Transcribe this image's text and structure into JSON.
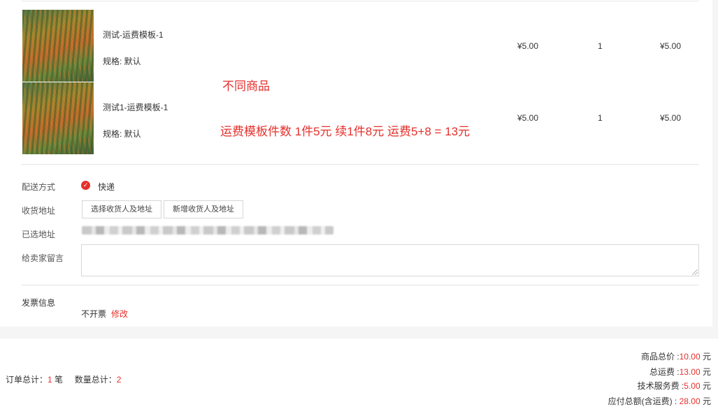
{
  "products": [
    {
      "name": "测试-运费模板-1",
      "spec": "规格: 默认",
      "price": "¥5.00",
      "qty": "1",
      "subtotal": "¥5.00"
    },
    {
      "name": "测试1-运费模板-1",
      "spec": "规格: 默认",
      "price": "¥5.00",
      "qty": "1",
      "subtotal": "¥5.00"
    }
  ],
  "annotations": {
    "different_products": "不同商品",
    "shipping_calc": "运费模板件数  1件5元 续1件8元 运费5+8 = 13元"
  },
  "delivery": {
    "label": "配送方式",
    "option_icon": "check-circle-icon",
    "option": "快递"
  },
  "address": {
    "label": "收货地址",
    "select_button": "选择收货人及地址",
    "add_button": "新增收货人及地址",
    "selected_label": "已选地址"
  },
  "message": {
    "label": "给卖家留言",
    "value": ""
  },
  "invoice": {
    "label": "发票信息",
    "value": "不开票",
    "edit": "修改"
  },
  "summary": {
    "order_total_label": "订单总计：",
    "order_total_value": "1",
    "order_total_unit": "笔",
    "qty_total_label": "数量总计：",
    "qty_total_value": "2",
    "goods_total_label": "商品总价 :",
    "goods_total_value": "10.00",
    "shipping_total_label": "总运费 :",
    "shipping_total_value": "13.00",
    "service_fee_label": "技术服务费 :",
    "service_fee_value": "5.00",
    "payable_label": "应付总额(含运费) : ",
    "payable_value": "28.00",
    "currency": "元"
  },
  "colors": {
    "accent": "#e4302c",
    "border": "#d6d6d6",
    "page_bg": "#f5f5f5"
  }
}
